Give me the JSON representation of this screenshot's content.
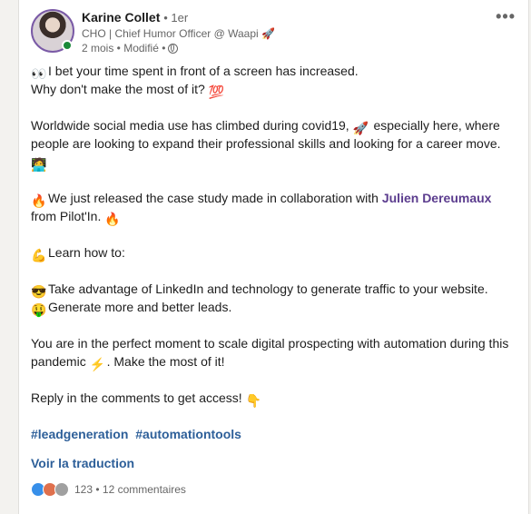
{
  "author": {
    "name": "Karine Collet",
    "degree": "• 1er",
    "headline": "CHO | Chief Humor Officer @ Waapi 🚀",
    "meta": "2 mois • Modifié •"
  },
  "more_label": "•••",
  "body": {
    "l1": "I bet your time spent in front of a screen has increased.",
    "l2": "Why don't make the most of it?",
    "l3": "Worldwide social media use has climbed during covid19,",
    "l3b": "especially here, where people are looking to expand their professional skills and looking for a career move.",
    "l4a": "We just released the case study made in collaboration with",
    "mention": "Julien Dereumaux",
    "l4b": "from Pilot'In.",
    "l5": "Learn how to:",
    "l6": "Take advantage of LinkedIn and technology to generate traffic to your website.",
    "l7": "Generate more and better leads.",
    "l8": "You are in the perfect moment to scale digital prospecting with automation during this pandemic",
    "l8b": ". Make the most of it!",
    "l9": "Reply in the comments to get access!"
  },
  "hashtags": [
    "#leadgeneration",
    "#automationtools"
  ],
  "translate_label": "Voir la traduction",
  "social": {
    "counts": "123 • 12 commentaires"
  }
}
